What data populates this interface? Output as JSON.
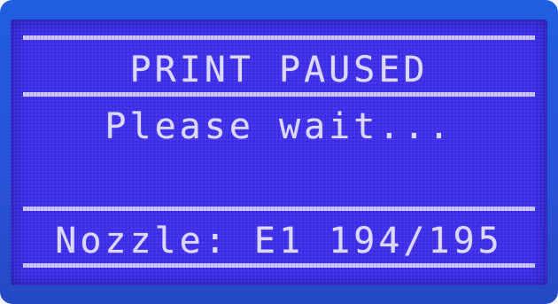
{
  "display": {
    "title": "PRINT PAUSED",
    "message": "Please wait...",
    "status_line": "Nozzle: E1 194/195"
  },
  "colors": {
    "frame": "#2a52d8",
    "screen": "#3a2ce6",
    "text": "#dcd8ff"
  }
}
